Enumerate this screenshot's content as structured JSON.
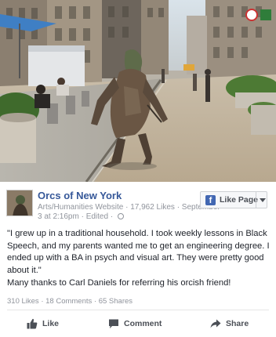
{
  "post": {
    "page_name": "Orcs of New York",
    "category": "Arts/Humanities Website",
    "likes_count": "17,962 Likes",
    "date_partial": "September",
    "time": "3 at 2:16pm",
    "edited": "Edited",
    "like_page_label": "Like Page",
    "quote": "\"I grew up in a traditional household. I took weekly lessons in Black Speech, and my parents wanted me to get an engineering degree. I ended up with a BA in psych and visual art. They were pretty good about it.\"",
    "thanks": "Many thanks to Carl Daniels for referring his orcish friend!",
    "stats": {
      "likes": "310 Likes",
      "comments": "18 Comments",
      "shares": "65 Shares"
    },
    "actions": {
      "like": "Like",
      "comment": "Comment",
      "share": "Share"
    }
  },
  "icons": {
    "fb_logo": "facebook-logo-icon",
    "globe": "globe-icon",
    "caret": "caret-down-icon",
    "like": "thumbs-up-icon",
    "comment": "speech-bubble-icon",
    "share": "share-arrow-icon"
  },
  "colors": {
    "link_blue": "#365899",
    "fb_blue": "#4267b2",
    "meta_gray": "#90949c",
    "action_gray": "#4b4f56"
  }
}
